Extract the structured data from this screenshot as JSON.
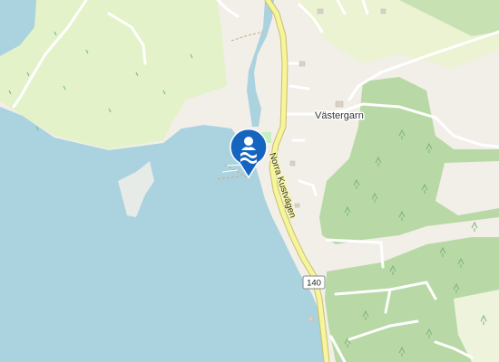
{
  "map": {
    "colors": {
      "water": "#a9d3df",
      "land": "#f2efe9",
      "grass": "#e4f2c9",
      "forest": "#b6d8a4",
      "major_road": "#f6f59b",
      "road_casing": "#c9bf6e",
      "minor_road": "#ffffff",
      "marker": "#1565c0"
    },
    "places": [
      {
        "label": "Västergarn"
      }
    ],
    "roads": [
      {
        "label": "Norra Kustvägen"
      }
    ],
    "shields": [
      {
        "label": "140"
      }
    ],
    "markers": [
      {
        "icon": "swimming-icon",
        "color": "#1565c0"
      }
    ]
  }
}
